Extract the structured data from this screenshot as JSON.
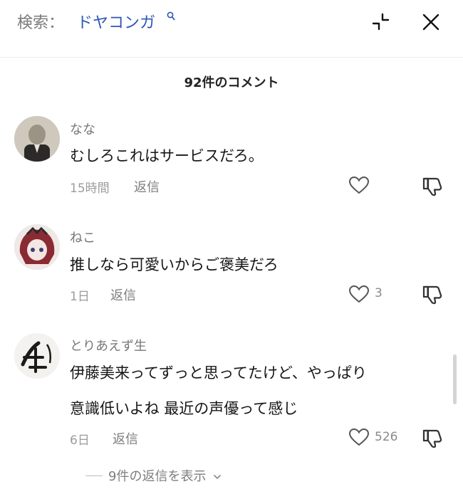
{
  "search": {
    "label": "検索：",
    "query": "ドヤコンガ"
  },
  "comment_count": "92件のコメント",
  "comments": [
    {
      "username": "なな",
      "lines": [
        "むしろこれはサービスだろ。"
      ],
      "time": "15時間",
      "reply_label": "返信",
      "likes": ""
    },
    {
      "username": "ねこ",
      "lines": [
        "推しなら可愛いからご褒美だろ"
      ],
      "time": "1日",
      "reply_label": "返信",
      "likes": "3"
    },
    {
      "username": "とりあえず生",
      "lines": [
        "伊藤美来ってずっと思ってたけど、やっぱり",
        "意識低いよね 最近の声優って感じ"
      ],
      "time": "6日",
      "reply_label": "返信",
      "likes": "526"
    }
  ],
  "view_replies": "9件の返信を表示",
  "colors": {
    "accent": "#2e57b8",
    "muted": "#7e7e7e"
  },
  "icons": [
    "search-icon",
    "collapse-icon",
    "close-icon",
    "heart-icon",
    "thumbs-down-icon",
    "chevron-down-icon"
  ]
}
